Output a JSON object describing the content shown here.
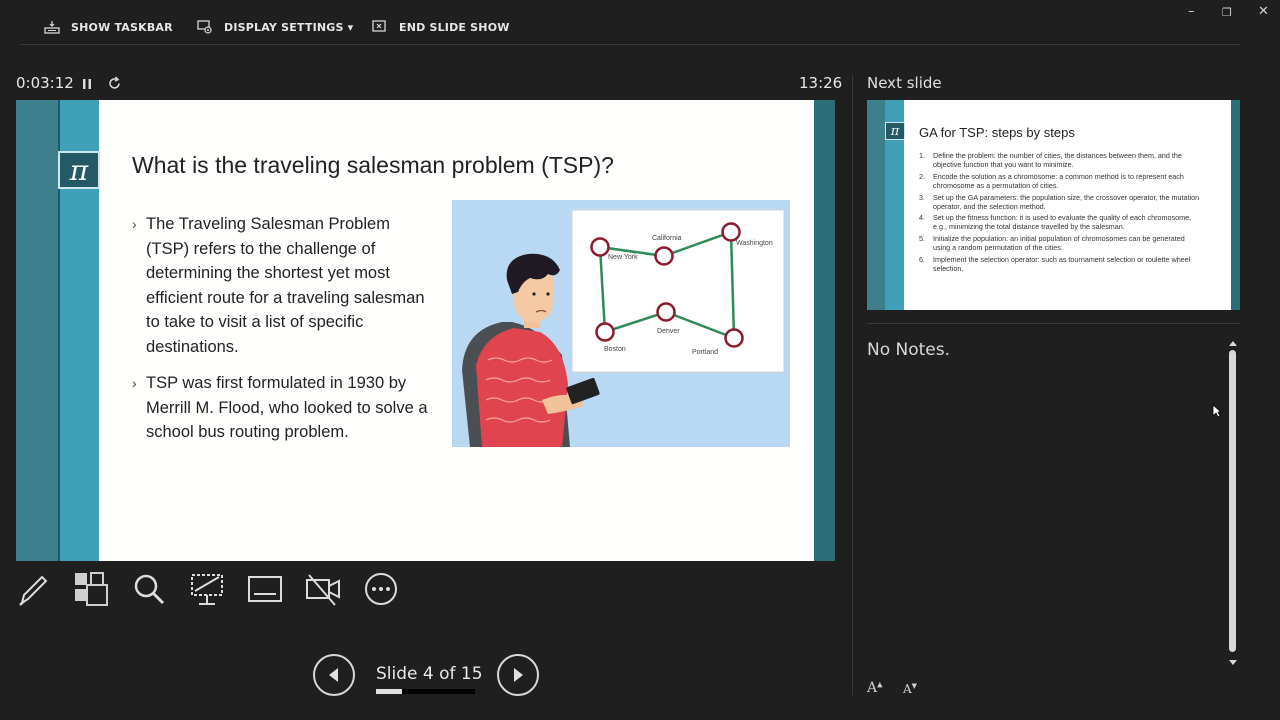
{
  "topbar": {
    "show_taskbar": "SHOW TASKBAR",
    "display_settings": "DISPLAY SETTINGS ▾",
    "end_slide_show": "END SLIDE SHOW"
  },
  "window": {
    "minimize": "–",
    "restore": "❐",
    "close": "✕"
  },
  "timer": {
    "elapsed": "0:03:12",
    "clock": "13:26"
  },
  "slide": {
    "title": "What is the traveling salesman problem (TSP)?",
    "pi_symbol": "π",
    "bullets": [
      "The Traveling Salesman Problem (TSP) refers to the challenge of determining the shortest yet most efficient route for a traveling salesman to take to visit a list of specific destinations.",
      "TSP was first formulated in 1930 by Merrill M.  Flood, who looked to solve a school bus routing problem."
    ],
    "map_labels": {
      "new_york": "New York",
      "california": "California",
      "washington": "Washington",
      "boston": "Boston",
      "denver": "Denver",
      "portland": "Portland"
    }
  },
  "navigation": {
    "slide_label": "Slide 4 of 15",
    "current_slide": 4,
    "total_slides": 15,
    "progress_fraction": 0.267
  },
  "next_slide": {
    "label": "Next slide",
    "title": "GA for TSP: steps by steps",
    "pi_symbol": "π",
    "steps": [
      {
        "n": "1.",
        "text": "Define the problem: the number of cities, the distances between them, and the objective function that you want to minimize."
      },
      {
        "n": "2.",
        "text": "Encode the solution as a chromosome: a common method is to represent each chromosome as a permutation of cities."
      },
      {
        "n": "3.",
        "text": "Set up the GA parameters: the population size, the crossover operator, the mutation operator, and the selection method."
      },
      {
        "n": "4.",
        "text": "Set up the fitness function: it is used to evaluate the quality of each chromosome, e.g., minimizing the total distance travelled by the salesman."
      },
      {
        "n": "5.",
        "text": "Initialize the population: an initial population of chromosomes can be generated using a random permutation of the cities."
      },
      {
        "n": "6.",
        "text": "Implement the selection operator: such as tournament selection or roulette wheel selection."
      }
    ]
  },
  "notes": {
    "text": "No Notes."
  },
  "font_controls": {
    "increase": "A",
    "decrease": "A"
  },
  "colors": {
    "background": "#1f1f1f",
    "slide_band_dark": "#3d7f8c",
    "slide_band_light": "#3fa0b8",
    "map_route": "#2e8b57",
    "map_node": "#8b1a2b"
  }
}
